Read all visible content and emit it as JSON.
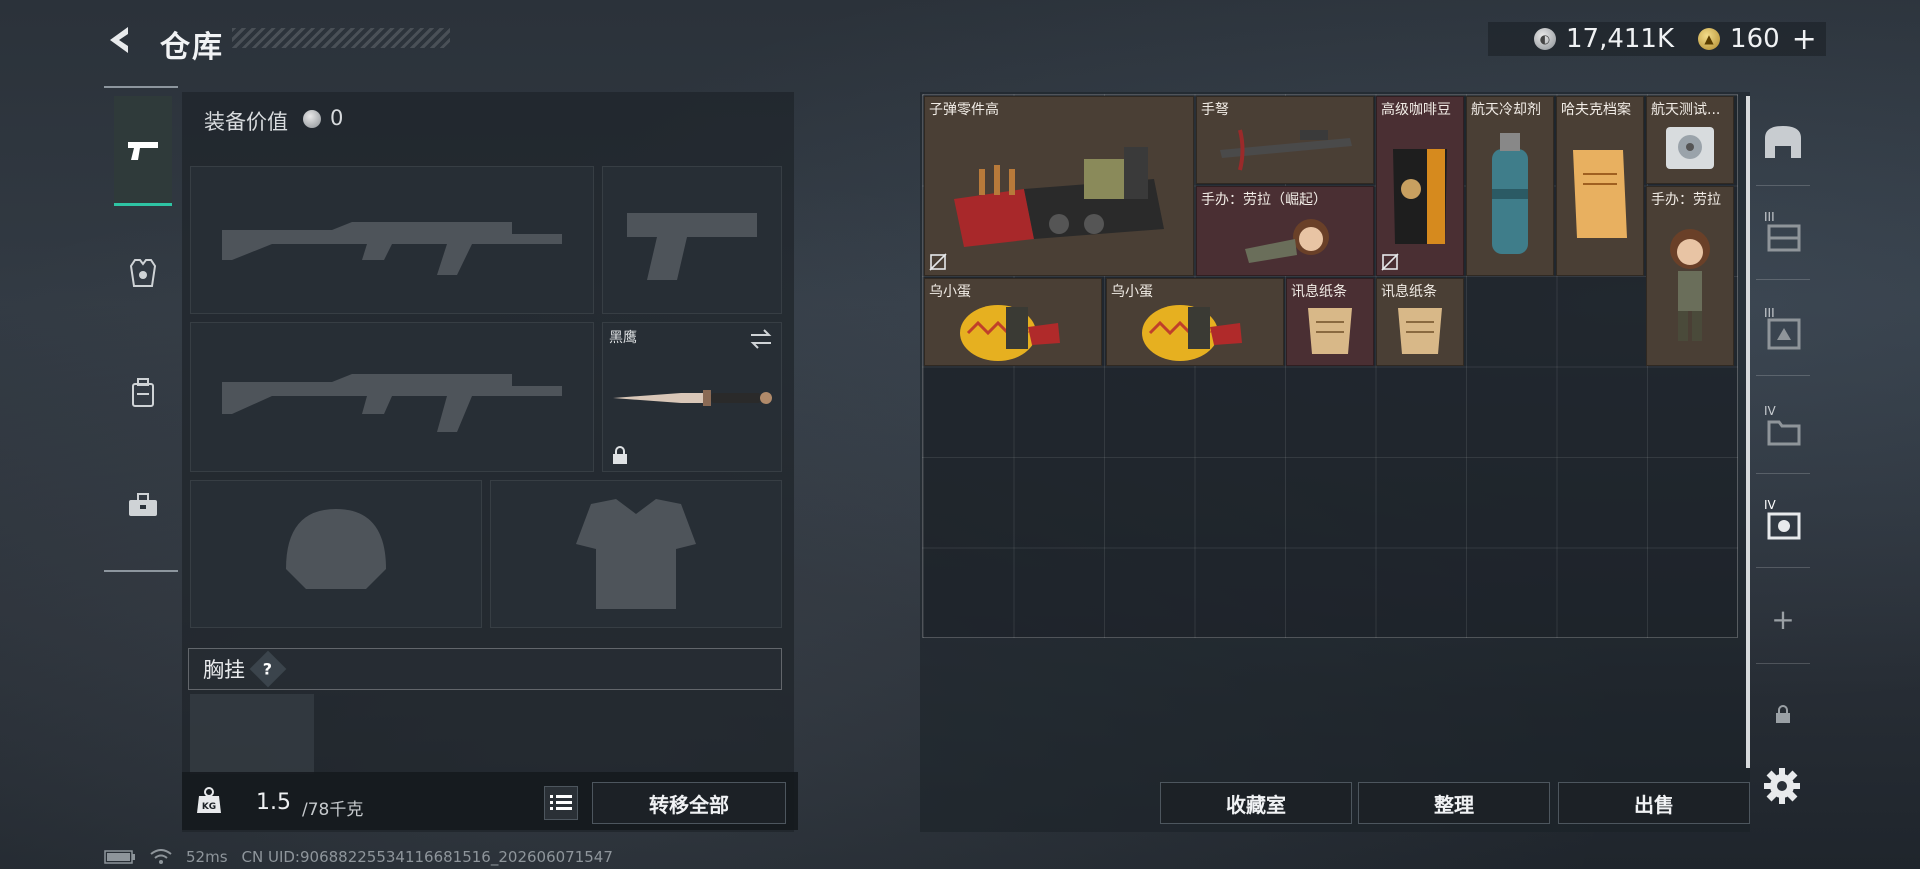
{
  "header": {
    "title": "仓库",
    "silver_value": "17,411K",
    "gold_value": "160",
    "plus_label": "+"
  },
  "loadout": {
    "equip_value_label": "装备价值",
    "equip_value": "0",
    "melee_name": "黑鹰",
    "chest_label": "胸挂",
    "chest_help": "?",
    "weight_value": "1.5",
    "weight_max": "/78千克",
    "transfer_all_label": "转移全部"
  },
  "inventory": {
    "items": [
      {
        "name": "子弹零件高",
        "color": "brown"
      },
      {
        "name": "手弩",
        "color": "brown"
      },
      {
        "name": "高级咖啡豆",
        "color": "maroon"
      },
      {
        "name": "航天冷却剂",
        "color": "brown"
      },
      {
        "name": "哈夫克档案",
        "color": "brown"
      },
      {
        "name": "航天测试...",
        "color": "brown"
      },
      {
        "name": "手办：劳拉（崛起）",
        "color": "maroon"
      },
      {
        "name": "手办：劳拉",
        "color": "brown"
      },
      {
        "name": "乌小蛋",
        "color": "brown"
      },
      {
        "name": "乌小蛋",
        "color": "brown"
      },
      {
        "name": "讯息纸条",
        "color": "maroon"
      },
      {
        "name": "讯息纸条",
        "color": "brown"
      }
    ],
    "buttons": {
      "collection": "收藏室",
      "sort": "整理",
      "sell": "出售"
    }
  },
  "side_tabs": {
    "tab3_label": "III",
    "tab4_label": "III",
    "tab5_label": "IV",
    "tab6_label": "IV",
    "add_label": "+"
  },
  "status": {
    "ping": "52ms",
    "uid": "CN UID:9068822553411668​1516_202606071547"
  }
}
